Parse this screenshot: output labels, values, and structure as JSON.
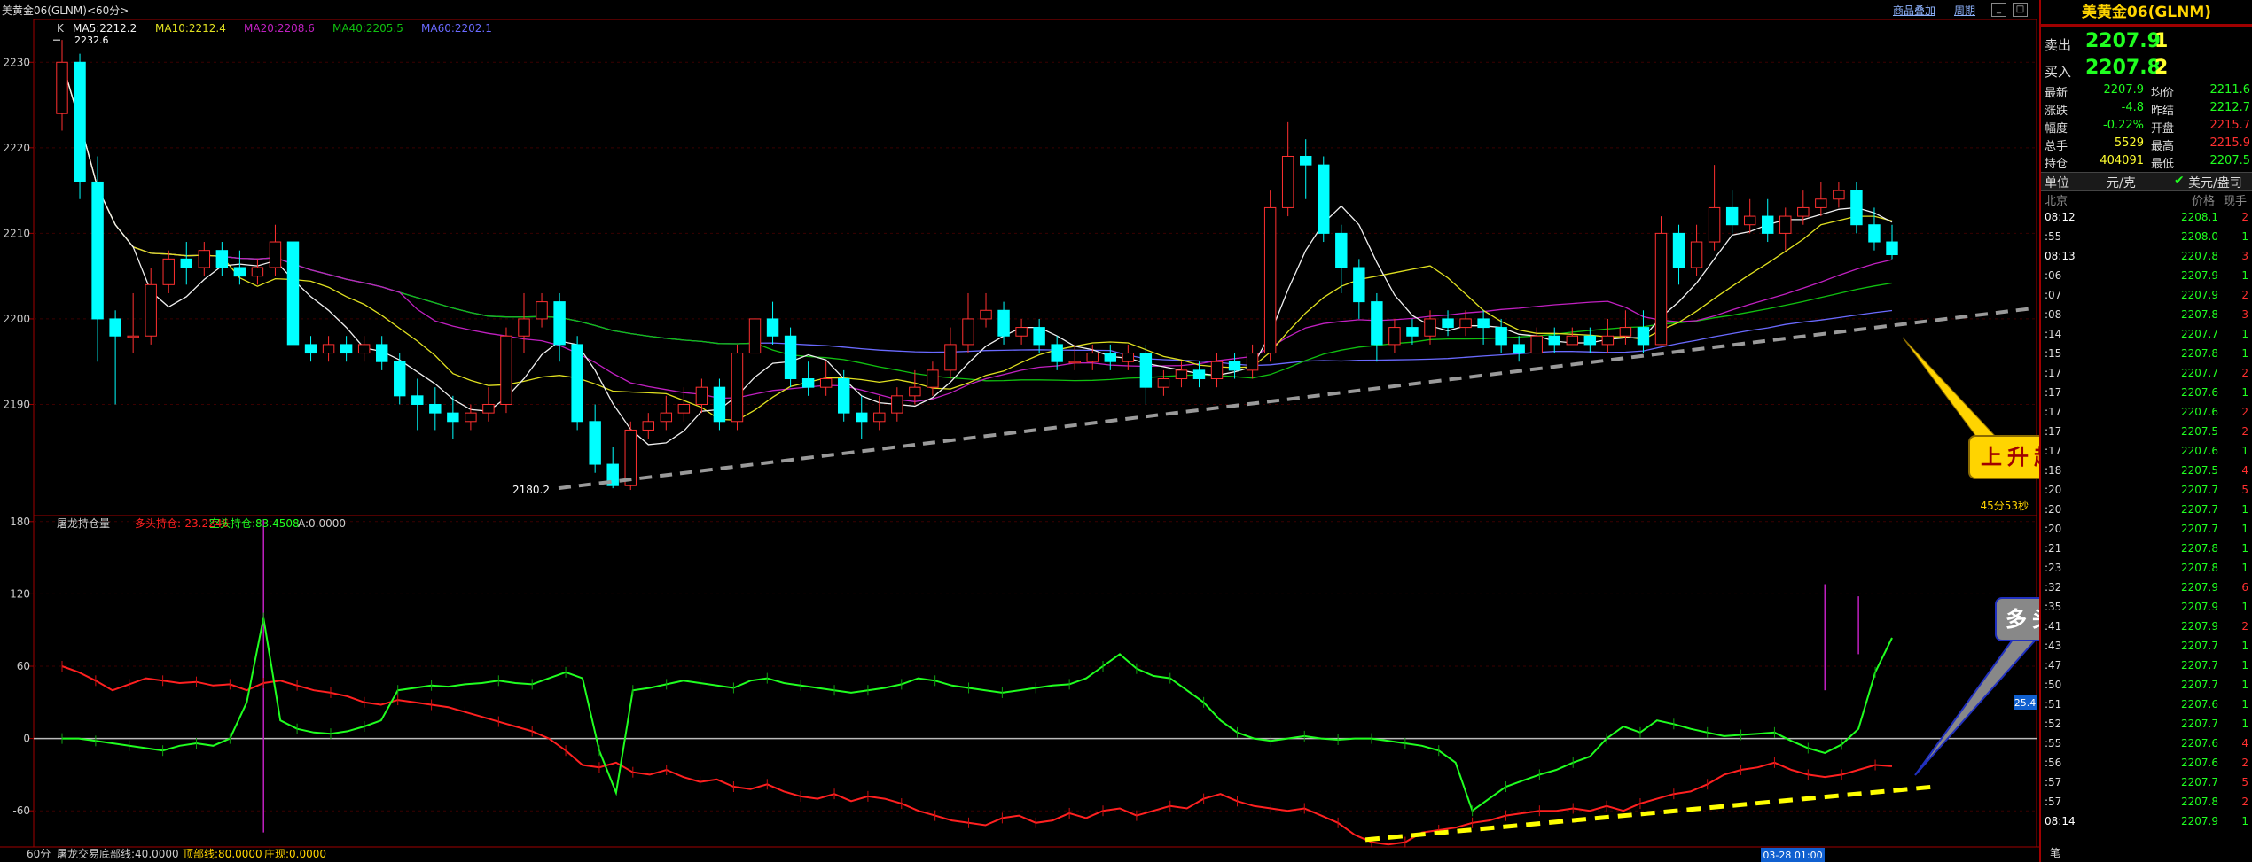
{
  "window": {
    "title": "美黄金06(GLNM)<60分>",
    "menus": [
      "商品叠加",
      "周期"
    ],
    "buttons": [
      "_",
      "□"
    ]
  },
  "main_legend": {
    "k_label": "K",
    "ma5": "MA5:2212.2",
    "ma10": "MA10:2212.4",
    "ma20": "MA20:2208.6",
    "ma40": "MA40:2205.5",
    "ma60": "MA60:2202.1"
  },
  "sub_legend": {
    "name": "屠龙持仓量",
    "long": "多头持仓:-23.2246",
    "short": "空头持仓:83.4508",
    "a": "A:0.0000"
  },
  "bottom_legend": {
    "period": "60分",
    "name": "屠龙交易",
    "bottom": "底部线:40.0000",
    "top": "顶部线:80.0000",
    "dealer": "庄现:0.0000"
  },
  "chart_data": [
    {
      "type": "candlestick",
      "ylim": [
        2177,
        2235
      ],
      "yticks": [
        2190,
        2200,
        2210,
        2220,
        2230
      ],
      "high_label": "2232.6",
      "low_label": "2180.2",
      "countdown": "45分53秒",
      "candles": [
        [
          2224,
          2230,
          2232.6,
          2222
        ],
        [
          2230,
          2216,
          2231,
          2214
        ],
        [
          2216,
          2200,
          2219,
          2195
        ],
        [
          2200,
          2198,
          2201,
          2190
        ],
        [
          2198,
          2198,
          2203,
          2196
        ],
        [
          2198,
          2204,
          2206,
          2197
        ],
        [
          2204,
          2207,
          2208,
          2203
        ],
        [
          2207,
          2206,
          2209,
          2204
        ],
        [
          2206,
          2208,
          2209,
          2205
        ],
        [
          2208,
          2206,
          2209,
          2205
        ],
        [
          2206,
          2205,
          2208,
          2204
        ],
        [
          2205,
          2206,
          2207,
          2204
        ],
        [
          2206,
          2209,
          2211,
          2205
        ],
        [
          2209,
          2197,
          2210,
          2196
        ],
        [
          2197,
          2196,
          2198,
          2195
        ],
        [
          2196,
          2197,
          2198,
          2195
        ],
        [
          2197,
          2196,
          2198,
          2195
        ],
        [
          2196,
          2197,
          2198,
          2195
        ],
        [
          2197,
          2195,
          2198,
          2194
        ],
        [
          2195,
          2191,
          2196,
          2190
        ],
        [
          2191,
          2190,
          2193,
          2187
        ],
        [
          2190,
          2189,
          2192,
          2187
        ],
        [
          2189,
          2188,
          2191,
          2186
        ],
        [
          2188,
          2189,
          2190,
          2187
        ],
        [
          2189,
          2190,
          2192,
          2188
        ],
        [
          2190,
          2198,
          2199,
          2189
        ],
        [
          2198,
          2200,
          2203,
          2196
        ],
        [
          2200,
          2202,
          2203,
          2199
        ],
        [
          2202,
          2197,
          2203,
          2195
        ],
        [
          2197,
          2188,
          2198,
          2187
        ],
        [
          2188,
          2183,
          2190,
          2182
        ],
        [
          2183,
          2180.5,
          2185,
          2180.2
        ],
        [
          2180.5,
          2187,
          2188,
          2180
        ],
        [
          2187,
          2188,
          2189,
          2186
        ],
        [
          2188,
          2189,
          2191,
          2187
        ],
        [
          2189,
          2190,
          2192,
          2188
        ],
        [
          2190,
          2192,
          2193,
          2189
        ],
        [
          2192,
          2188,
          2193,
          2187
        ],
        [
          2188,
          2196,
          2197,
          2187
        ],
        [
          2196,
          2200,
          2201,
          2195
        ],
        [
          2200,
          2198,
          2202,
          2197
        ],
        [
          2198,
          2193,
          2199,
          2192
        ],
        [
          2193,
          2192,
          2195,
          2191
        ],
        [
          2192,
          2193,
          2195,
          2191
        ],
        [
          2193,
          2189,
          2194,
          2188
        ],
        [
          2189,
          2188,
          2191,
          2186
        ],
        [
          2188,
          2189,
          2191,
          2187
        ],
        [
          2189,
          2191,
          2192,
          2188
        ],
        [
          2191,
          2192,
          2194,
          2190
        ],
        [
          2192,
          2194,
          2195,
          2191
        ],
        [
          2194,
          2197,
          2199,
          2193
        ],
        [
          2197,
          2200,
          2203,
          2196
        ],
        [
          2200,
          2201,
          2203,
          2199
        ],
        [
          2201,
          2198,
          2202,
          2197
        ],
        [
          2198,
          2199,
          2200,
          2197
        ],
        [
          2199,
          2197,
          2200,
          2196
        ],
        [
          2197,
          2195,
          2198,
          2194
        ],
        [
          2195,
          2195,
          2197,
          2194
        ],
        [
          2195,
          2196,
          2197,
          2194
        ],
        [
          2196,
          2195,
          2197,
          2194
        ],
        [
          2195,
          2196,
          2197,
          2194
        ],
        [
          2196,
          2192,
          2197,
          2190
        ],
        [
          2192,
          2193,
          2194,
          2191
        ],
        [
          2193,
          2194,
          2195,
          2192
        ],
        [
          2194,
          2193,
          2195,
          2192
        ],
        [
          2193,
          2195,
          2196,
          2192
        ],
        [
          2195,
          2194,
          2196,
          2193
        ],
        [
          2194,
          2196,
          2197,
          2193
        ],
        [
          2196,
          2213,
          2215,
          2195
        ],
        [
          2213,
          2219,
          2223,
          2212
        ],
        [
          2219,
          2218,
          2221,
          2214
        ],
        [
          2218,
          2210,
          2219,
          2209
        ],
        [
          2210,
          2206,
          2211,
          2203
        ],
        [
          2206,
          2202,
          2207,
          2200
        ],
        [
          2202,
          2197,
          2203,
          2195
        ],
        [
          2197,
          2199,
          2200,
          2196
        ],
        [
          2199,
          2198,
          2200,
          2197
        ],
        [
          2198,
          2200,
          2201,
          2197
        ],
        [
          2200,
          2199,
          2201,
          2198
        ],
        [
          2199,
          2200,
          2201,
          2198
        ],
        [
          2200,
          2199,
          2201,
          2197
        ],
        [
          2199,
          2197,
          2200,
          2196
        ],
        [
          2197,
          2196,
          2198,
          2195
        ],
        [
          2196,
          2198,
          2199,
          2196
        ],
        [
          2198,
          2197,
          2199,
          2196
        ],
        [
          2197,
          2198,
          2199,
          2197
        ],
        [
          2198,
          2197,
          2199,
          2196
        ],
        [
          2197,
          2198,
          2200,
          2196
        ],
        [
          2198,
          2199,
          2201,
          2197
        ],
        [
          2199,
          2197,
          2201,
          2196
        ],
        [
          2197,
          2210,
          2212,
          2197
        ],
        [
          2210,
          2206,
          2211,
          2204
        ],
        [
          2206,
          2209,
          2211,
          2205
        ],
        [
          2209,
          2213,
          2218,
          2208
        ],
        [
          2213,
          2211,
          2215,
          2210
        ],
        [
          2211,
          2212,
          2214,
          2210
        ],
        [
          2212,
          2210,
          2214,
          2209
        ],
        [
          2210,
          2212,
          2213,
          2208
        ],
        [
          2212,
          2213,
          2215,
          2211
        ],
        [
          2213,
          2214,
          2216,
          2212
        ],
        [
          2214,
          2215,
          2216,
          2213
        ],
        [
          2215,
          2211,
          2216,
          2210
        ],
        [
          2211,
          2209,
          2213,
          2208
        ],
        [
          2209,
          2207.5,
          2211,
          2207
        ]
      ]
    },
    {
      "type": "line",
      "ylim": [
        -90,
        185
      ],
      "yticks": [
        -60,
        0,
        60,
        120,
        180
      ],
      "current_value_label": "25.4",
      "x_label": "03-28 01:00",
      "series": [
        {
          "name": "多头持仓",
          "color": "#ff2020",
          "values": [
            60,
            55,
            48,
            40,
            45,
            50,
            48,
            46,
            47,
            44,
            45,
            40,
            46,
            48,
            44,
            40,
            38,
            35,
            30,
            28,
            32,
            30,
            28,
            26,
            22,
            18,
            14,
            10,
            6,
            0,
            -10,
            -22,
            -24,
            -20,
            -28,
            -30,
            -26,
            -32,
            -36,
            -34,
            -40,
            -42,
            -38,
            -44,
            -48,
            -50,
            -46,
            -52,
            -48,
            -50,
            -54,
            -60,
            -64,
            -68,
            -70,
            -72,
            -66,
            -64,
            -70,
            -68,
            -62,
            -66,
            -60,
            -58,
            -64,
            -60,
            -56,
            -58,
            -50,
            -46,
            -52,
            -56,
            -58,
            -60,
            -58,
            -64,
            -70,
            -80,
            -86,
            -88,
            -86,
            -78,
            -76,
            -74,
            -70,
            -68,
            -64,
            -62,
            -60,
            -60,
            -58,
            -60,
            -56,
            -60,
            -54,
            -50,
            -46,
            -44,
            -38,
            -30,
            -26,
            -24,
            -20,
            -26,
            -30,
            -32,
            -30,
            -26,
            -22,
            -23
          ]
        },
        {
          "name": "空头持仓",
          "color": "#20ff20",
          "values": [
            0,
            0,
            -2,
            -4,
            -6,
            -8,
            -10,
            -6,
            -4,
            -6,
            0,
            30,
            100,
            15,
            8,
            5,
            4,
            6,
            10,
            15,
            40,
            42,
            44,
            43,
            45,
            46,
            48,
            46,
            45,
            50,
            55,
            50,
            -10,
            -45,
            40,
            42,
            45,
            48,
            46,
            44,
            42,
            48,
            50,
            46,
            44,
            42,
            40,
            38,
            40,
            42,
            45,
            50,
            48,
            44,
            42,
            40,
            38,
            40,
            42,
            44,
            45,
            50,
            60,
            70,
            58,
            52,
            50,
            40,
            30,
            15,
            5,
            0,
            -2,
            0,
            2,
            0,
            -1,
            0,
            0,
            -2,
            -4,
            -6,
            -10,
            -20,
            -60,
            -50,
            -40,
            -35,
            -30,
            -26,
            -20,
            -15,
            0,
            10,
            5,
            15,
            12,
            8,
            5,
            2,
            3,
            4,
            5,
            -2,
            -8,
            -12,
            -5,
            8,
            55,
            83.5
          ]
        },
        {
          "name": "A",
          "color": "#ffffff",
          "values": [
            0,
            0
          ]
        }
      ]
    }
  ],
  "annotations": {
    "trendline_label": "上升趋势线",
    "position_label": "多头主力增仓"
  },
  "quote": {
    "symbol": "美黄金06(GLNM)",
    "sell_label": "卖出",
    "sell_price": "2207.9",
    "sell_qty": "1",
    "buy_label": "买入",
    "buy_price": "2207.8",
    "buy_qty": "2",
    "stats": [
      {
        "label": "最新",
        "value": "2207.9",
        "label2": "均价",
        "value2": "2211.6"
      },
      {
        "label": "涨跌",
        "value": "-4.8",
        "label2": "昨结",
        "value2": "2212.7"
      },
      {
        "label": "幅度",
        "value": "-0.22%",
        "label2": "开盘",
        "value2": "2215.7"
      },
      {
        "label": "总手",
        "value": "5529",
        "label2": "最高",
        "value2": "2215.9"
      },
      {
        "label": "持仓",
        "value": "404091",
        "label2": "最低",
        "value2": "2207.5"
      }
    ],
    "unit_label": "单位",
    "unit_value": "元/克",
    "unit_option": "美元/盎司",
    "tick_headers": [
      "北京",
      "价格",
      "现手"
    ],
    "ticks": [
      {
        "time": "08:12",
        "price": "2208.1",
        "vol": "2"
      },
      {
        "time": ":55",
        "price": "2208.0",
        "vol": "1"
      },
      {
        "time": "08:13",
        "price": "2207.8",
        "vol": "3"
      },
      {
        "time": ":06",
        "price": "2207.9",
        "vol": "1"
      },
      {
        "time": ":07",
        "price": "2207.9",
        "vol": "2"
      },
      {
        "time": ":08",
        "price": "2207.8",
        "vol": "3"
      },
      {
        "time": ":14",
        "price": "2207.7",
        "vol": "1"
      },
      {
        "time": ":15",
        "price": "2207.8",
        "vol": "1"
      },
      {
        "time": ":17",
        "price": "2207.7",
        "vol": "2"
      },
      {
        "time": ":17",
        "price": "2207.6",
        "vol": "1"
      },
      {
        "time": ":17",
        "price": "2207.6",
        "vol": "2"
      },
      {
        "time": ":17",
        "price": "2207.5",
        "vol": "2"
      },
      {
        "time": ":17",
        "price": "2207.6",
        "vol": "1"
      },
      {
        "time": ":18",
        "price": "2207.5",
        "vol": "4"
      },
      {
        "time": ":20",
        "price": "2207.7",
        "vol": "5"
      },
      {
        "time": ":20",
        "price": "2207.7",
        "vol": "1"
      },
      {
        "time": ":20",
        "price": "2207.7",
        "vol": "1"
      },
      {
        "time": ":21",
        "price": "2207.8",
        "vol": "1"
      },
      {
        "time": ":23",
        "price": "2207.8",
        "vol": "1"
      },
      {
        "time": ":32",
        "price": "2207.9",
        "vol": "6"
      },
      {
        "time": ":35",
        "price": "2207.9",
        "vol": "1"
      },
      {
        "time": ":41",
        "price": "2207.9",
        "vol": "2"
      },
      {
        "time": ":43",
        "price": "2207.7",
        "vol": "1"
      },
      {
        "time": ":47",
        "price": "2207.7",
        "vol": "1"
      },
      {
        "time": ":50",
        "price": "2207.7",
        "vol": "1"
      },
      {
        "time": ":51",
        "price": "2207.6",
        "vol": "1"
      },
      {
        "time": ":52",
        "price": "2207.7",
        "vol": "1"
      },
      {
        "time": ":55",
        "price": "2207.6",
        "vol": "4"
      },
      {
        "time": ":56",
        "price": "2207.6",
        "vol": "2"
      },
      {
        "time": ":57",
        "price": "2207.7",
        "vol": "5"
      },
      {
        "time": ":57",
        "price": "2207.8",
        "vol": "2"
      },
      {
        "time": "08:14",
        "price": "2207.9",
        "vol": "1"
      }
    ],
    "footer_tab": "笔"
  }
}
